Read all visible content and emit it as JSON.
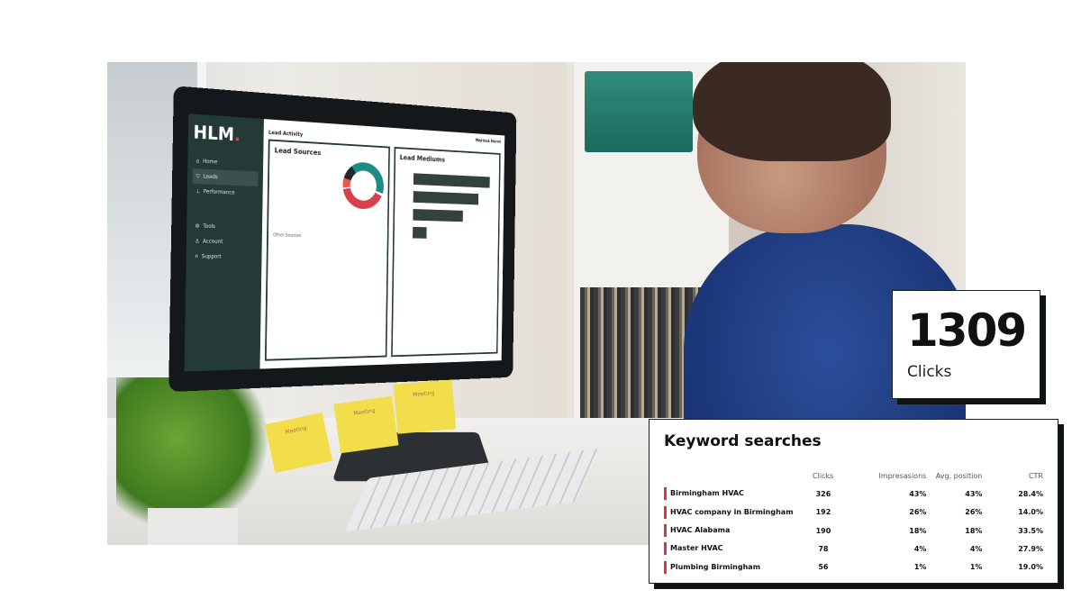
{
  "dashboard": {
    "brand": "HLM",
    "brand_dot": ".",
    "user_name": "Marissa Nerol",
    "page_title": "Lead Activity",
    "nav": [
      {
        "label": "Home",
        "icon": "home-icon"
      },
      {
        "label": "Leads",
        "icon": "filter-icon"
      },
      {
        "label": "Performance",
        "icon": "chart-icon"
      },
      {
        "label": "Tools",
        "icon": "gear-icon"
      },
      {
        "label": "Account",
        "icon": "user-icon"
      },
      {
        "label": "Support",
        "icon": "headset-icon"
      }
    ],
    "lead_sources_title": "Lead Sources",
    "other_sources_title": "Other Sources",
    "lead_mediums_title": "Lead Mediums",
    "colors": {
      "sidebar": "#233a36",
      "teal": "#1f8b86",
      "red": "#d9404b"
    }
  },
  "sticky_notes": [
    "Meeting",
    "Meeting",
    "Meeting"
  ],
  "stat": {
    "value": "1309",
    "label": "Clicks"
  },
  "keywords": {
    "title": "Keyword searches",
    "columns": [
      "Clicks",
      "Impresasions",
      "Avg. position",
      "CTR"
    ],
    "rows": [
      [
        "Birmingham HVAC",
        "326",
        "43%",
        "43%",
        "28.4%"
      ],
      [
        "HVAC company in Birmingham",
        "192",
        "26%",
        "26%",
        "14.0%"
      ],
      [
        "HVAC Alabama",
        "190",
        "18%",
        "18%",
        "33.5%"
      ],
      [
        "Master HVAC",
        "78",
        "4%",
        "4%",
        "27.9%"
      ],
      [
        "Plumbing Birmingham",
        "56",
        "1%",
        "1%",
        "19.0%"
      ]
    ],
    "accent": "#e2343f"
  }
}
